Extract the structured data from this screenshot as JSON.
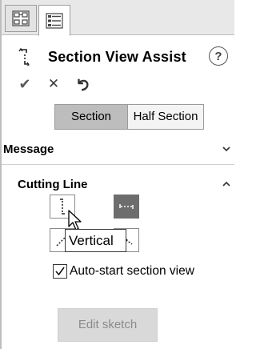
{
  "tabs": [
    {
      "name": "feature-manager",
      "icon": "feature-tree-icon",
      "active": false
    },
    {
      "name": "property-manager",
      "icon": "property-manager-icon",
      "active": true
    }
  ],
  "title": {
    "text": "Section View Assist",
    "icon": "section-view-icon",
    "help": "?"
  },
  "actions": {
    "ok": "✔",
    "cancel": "✕",
    "undo": "undo-icon"
  },
  "mode": {
    "options": [
      "Section",
      "Half Section"
    ],
    "selected": "Section"
  },
  "message_section": {
    "label": "Message",
    "expanded": false
  },
  "cutting_line": {
    "label": "Cutting Line",
    "expanded": true,
    "buttons": [
      "vertical",
      "horizontal",
      "auxiliary",
      "aligned"
    ],
    "selected": "horizontal",
    "tooltip": "Vertical"
  },
  "auto_start": {
    "label": "Auto-start section view",
    "checked": true
  },
  "edit_sketch": {
    "label": "Edit sketch",
    "enabled": false
  },
  "colors": {
    "selected_segment": "#bdbdbd",
    "panel_bg": "#ffffff",
    "tab_strip": "#e8e8e8"
  }
}
